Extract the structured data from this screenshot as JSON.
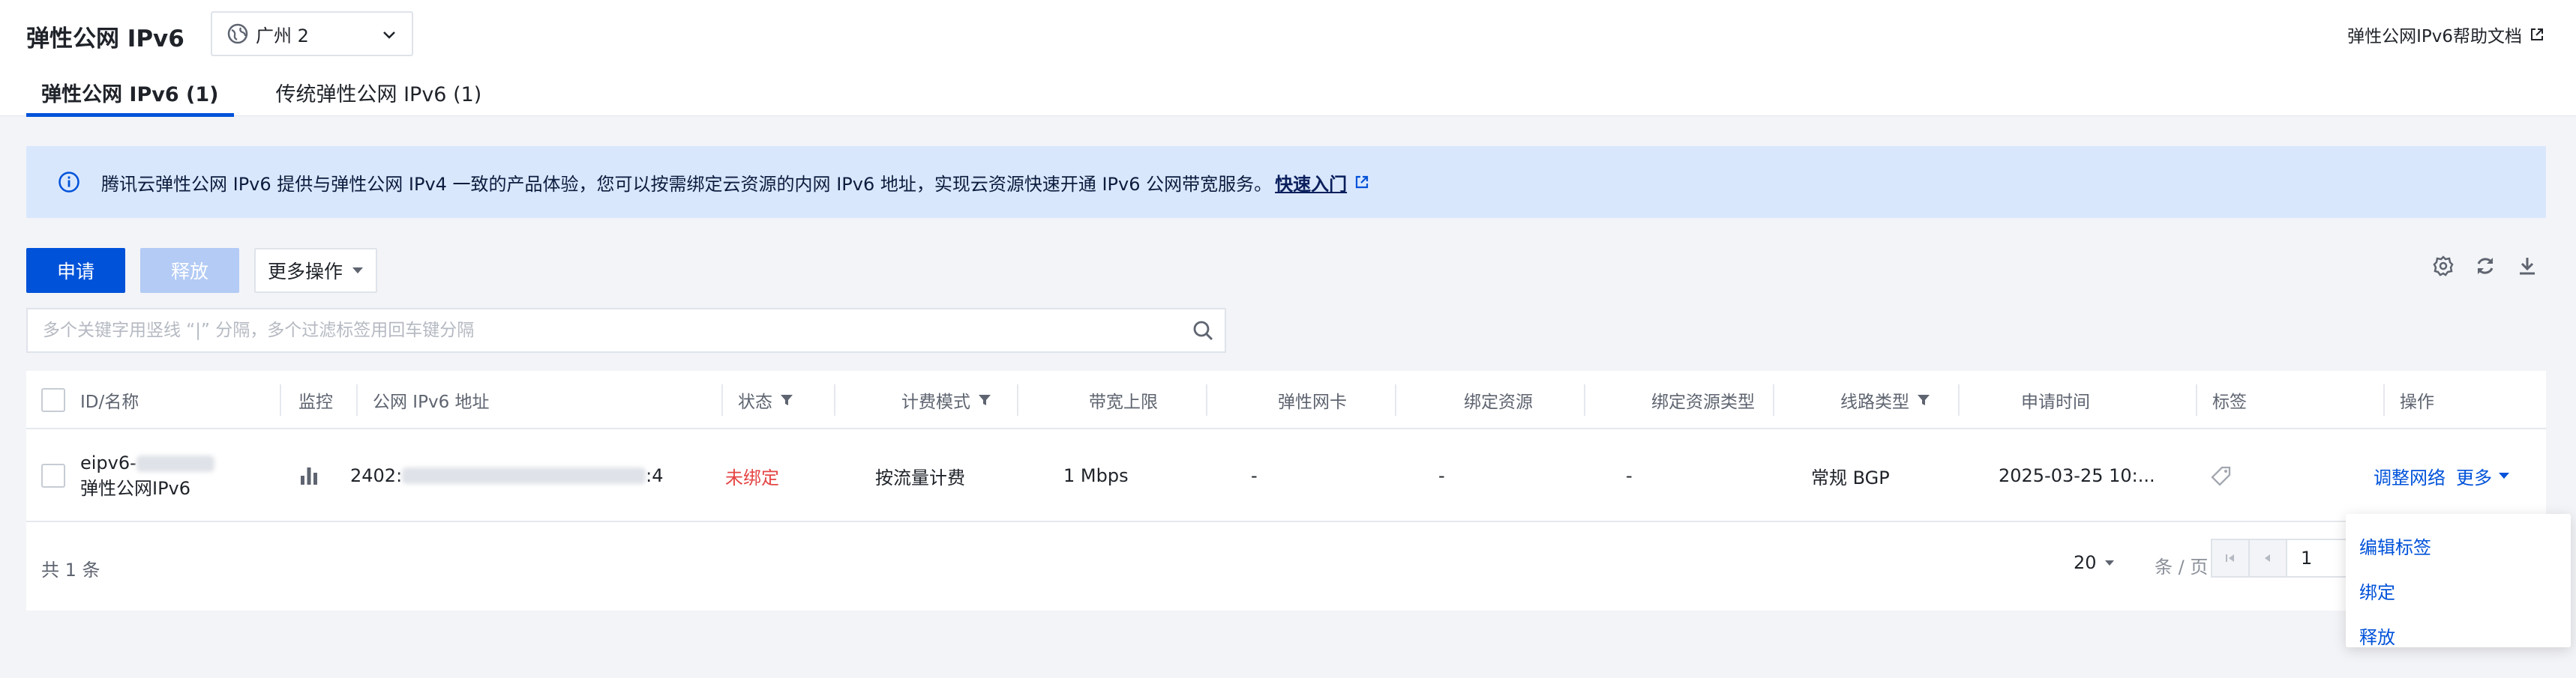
{
  "header": {
    "title": "弹性公网 IPv6",
    "region": "广州 2",
    "help_link": "弹性公网IPv6帮助文档"
  },
  "tabs": [
    {
      "label": "弹性公网 IPv6 (1)",
      "active": true
    },
    {
      "label": "传统弹性公网 IPv6 (1)",
      "active": false
    }
  ],
  "notice": {
    "text": "腾讯云弹性公网 IPv6 提供与弹性公网 IPv4 一致的产品体验，您可以按需绑定云资源的内网 IPv6 地址，实现云资源快速开通 IPv6 公网带宽服务。",
    "link": "快速入门"
  },
  "toolbar": {
    "apply": "申请",
    "release": "释放",
    "more": "更多操作"
  },
  "search": {
    "placeholder": "多个关键字用竖线 “|” 分隔，多个过滤标签用回车键分隔"
  },
  "table": {
    "columns": [
      "ID/名称",
      "监控",
      "公网 IPv6 地址",
      "状态",
      "计费模式",
      "带宽上限",
      "弹性网卡",
      "绑定资源",
      "绑定资源类型",
      "线路类型",
      "申请时间",
      "标签",
      "操作"
    ],
    "rows": [
      {
        "id_prefix": "eipv6-",
        "name": "弹性公网IPv6",
        "ipv6_prefix": "2402:",
        "ipv6_suffix": ":4",
        "status": "未绑定",
        "billing": "按流量计费",
        "bandwidth": "1 Mbps",
        "eni": "-",
        "bound_resource": "-",
        "bound_resource_type": "-",
        "line_type": "常规 BGP",
        "apply_time": "2025-03-25 10:...",
        "action_adjust": "调整网络",
        "action_more": "更多"
      }
    ]
  },
  "footer": {
    "total": "共 1 条",
    "page_size": "20",
    "per_page": "条 / 页",
    "page": "1"
  },
  "dropdown": {
    "items": [
      "编辑标签",
      "绑定",
      "释放"
    ]
  },
  "colors": {
    "primary": "#0052d9",
    "notice_bg": "#d9e7fd",
    "status_unbound": "#e54545"
  }
}
